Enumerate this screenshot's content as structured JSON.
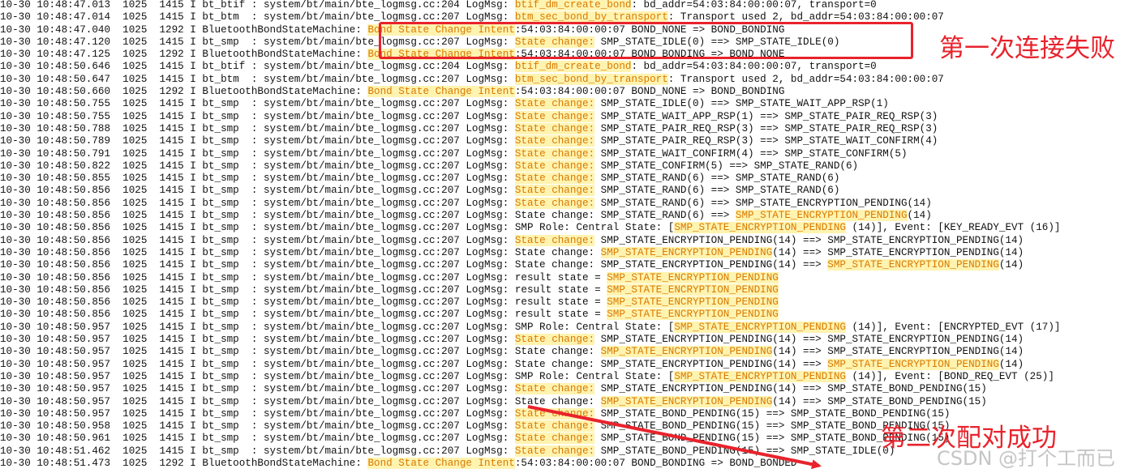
{
  "colors": {
    "highlight_bg": "#fff3b0",
    "highlight_text": "#d97a00",
    "annotation_red": "#e8232c"
  },
  "annotations": {
    "first_fail": "第一次连接失败",
    "second_success": "第二次配对成功"
  },
  "watermark": "CSDN @打个工而已",
  "log_lines": [
    [
      "10-30 10:48:47.013  1025  1415 I bt_btif : system/bt/main/bte_logmsg.cc:204 LogMsg: ",
      {
        "t": "btif_dm_create_bond",
        "h": true
      },
      ": bd_addr=54:03:84:00:00:07, transport=0"
    ],
    [
      "10-30 10:48:47.014  1025  1415 I bt_btm  : system/bt/main/bte_logmsg.cc:207 LogMsg: ",
      {
        "t": "btm_sec_bond_by_transport",
        "h": true
      },
      ": Transport used 2, bd_addr=54:03:84:00:00:07"
    ],
    [
      "10-30 10:48:47.040  1025  1292 I BluetoothBondStateMachine: ",
      {
        "t": "Bond State Change Intent",
        "h": true
      },
      ":54:03:84:00:00:07 BOND_NONE => BOND_BONDING"
    ],
    [
      "10-30 10:48:47.120  1025  1415 I bt_smp  : system/bt/main/bte_logmsg.cc:207 LogMsg: ",
      {
        "t": "State change:",
        "h": true
      },
      " SMP_STATE_IDLE(0) ==> SMP_STATE_IDLE(0)"
    ],
    [
      "10-30 10:48:47.125  1025  1292 I BluetoothBondStateMachine: ",
      {
        "t": "Bond State Change Intent",
        "h": true
      },
      ":54:03:84:00:00:07 BOND_BONDING => BOND_NONE"
    ],
    [
      "10-30 10:48:50.646  1025  1415 I bt_btif : system/bt/main/bte_logmsg.cc:204 LogMsg: ",
      {
        "t": "btif_dm_create_bond",
        "h": true
      },
      ": bd_addr=54:03:84:00:00:07, transport=0"
    ],
    [
      "10-30 10:48:50.647  1025  1415 I bt_btm  : system/bt/main/bte_logmsg.cc:207 LogMsg: ",
      {
        "t": "btm_sec_bond_by_transport",
        "h": true
      },
      ": Transport used 2, bd_addr=54:03:84:00:00:07"
    ],
    [
      "10-30 10:48:50.660  1025  1292 I BluetoothBondStateMachine: ",
      {
        "t": "Bond State Change Intent",
        "h": true
      },
      ":54:03:84:00:00:07 BOND_NONE => BOND_BONDING"
    ],
    [
      "10-30 10:48:50.755  1025  1415 I bt_smp  : system/bt/main/bte_logmsg.cc:207 LogMsg: ",
      {
        "t": "State change:",
        "h": true
      },
      " SMP_STATE_IDLE(0) ==> SMP_STATE_WAIT_APP_RSP(1)"
    ],
    [
      "10-30 10:48:50.755  1025  1415 I bt_smp  : system/bt/main/bte_logmsg.cc:207 LogMsg: ",
      {
        "t": "State change:",
        "h": true
      },
      " SMP_STATE_WAIT_APP_RSP(1) ==> SMP_STATE_PAIR_REQ_RSP(3)"
    ],
    [
      "10-30 10:48:50.788  1025  1415 I bt_smp  : system/bt/main/bte_logmsg.cc:207 LogMsg: ",
      {
        "t": "State change:",
        "h": true
      },
      " SMP_STATE_PAIR_REQ_RSP(3) ==> SMP_STATE_PAIR_REQ_RSP(3)"
    ],
    [
      "10-30 10:48:50.789  1025  1415 I bt_smp  : system/bt/main/bte_logmsg.cc:207 LogMsg: ",
      {
        "t": "State change:",
        "h": true
      },
      " SMP_STATE_PAIR_REQ_RSP(3) ==> SMP_STATE_WAIT_CONFIRM(4)"
    ],
    [
      "10-30 10:48:50.791  1025  1415 I bt_smp  : system/bt/main/bte_logmsg.cc:207 LogMsg: ",
      {
        "t": "State change:",
        "h": true
      },
      " SMP_STATE_WAIT_CONFIRM(4) ==> SMP_STATE_CONFIRM(5)"
    ],
    [
      "10-30 10:48:50.822  1025  1415 I bt_smp  : system/bt/main/bte_logmsg.cc:207 LogMsg: ",
      {
        "t": "State change:",
        "h": true
      },
      " SMP_STATE_CONFIRM(5) ==> SMP_STATE_RAND(6)"
    ],
    [
      "10-30 10:48:50.855  1025  1415 I bt_smp  : system/bt/main/bte_logmsg.cc:207 LogMsg: ",
      {
        "t": "State change:",
        "h": true
      },
      " SMP_STATE_RAND(6) ==> SMP_STATE_RAND(6)"
    ],
    [
      "10-30 10:48:50.856  1025  1415 I bt_smp  : system/bt/main/bte_logmsg.cc:207 LogMsg: ",
      {
        "t": "State change:",
        "h": true
      },
      " SMP_STATE_RAND(6) ==> SMP_STATE_RAND(6)"
    ],
    [
      "10-30 10:48:50.856  1025  1415 I bt_smp  : system/bt/main/bte_logmsg.cc:207 LogMsg: ",
      {
        "t": "State change:",
        "h": true
      },
      " SMP_STATE_RAND(6) ==> SMP_STATE_ENCRYPTION_PENDING(14)"
    ],
    [
      "10-30 10:48:50.856  1025  1415 I bt_smp  : system/bt/main/bte_logmsg.cc:207 LogMsg: State change: SMP_STATE_RAND(6) ==> ",
      {
        "t": "SMP_STATE_ENCRYPTION_PENDING",
        "h": true
      },
      "(14)"
    ],
    [
      "10-30 10:48:50.856  1025  1415 I bt_smp  : system/bt/main/bte_logmsg.cc:207 LogMsg: SMP Role: Central State: [",
      {
        "t": "SMP_STATE_ENCRYPTION_PENDING",
        "h": true
      },
      " (14)], Event: [KEY_READY_EVT (16)]"
    ],
    [
      "10-30 10:48:50.856  1025  1415 I bt_smp  : system/bt/main/bte_logmsg.cc:207 LogMsg: ",
      {
        "t": "State change:",
        "h": true
      },
      " SMP_STATE_ENCRYPTION_PENDING(14) ==> SMP_STATE_ENCRYPTION_PENDING(14)"
    ],
    [
      "10-30 10:48:50.856  1025  1415 I bt_smp  : system/bt/main/bte_logmsg.cc:207 LogMsg: State change: ",
      {
        "t": "SMP_STATE_ENCRYPTION_PENDING",
        "h": true
      },
      "(14) ==> SMP_STATE_ENCRYPTION_PENDING(14)"
    ],
    [
      "10-30 10:48:50.856  1025  1415 I bt_smp  : system/bt/main/bte_logmsg.cc:207 LogMsg: State change: SMP_STATE_ENCRYPTION_PENDING(14) ==> ",
      {
        "t": "SMP_STATE_ENCRYPTION_PENDING",
        "h": true
      },
      "(14)"
    ],
    [
      "10-30 10:48:50.856  1025  1415 I bt_smp  : system/bt/main/bte_logmsg.cc:207 LogMsg: result state = ",
      {
        "t": "SMP_STATE_ENCRYPTION_PENDING",
        "h": true
      },
      ""
    ],
    [
      "10-30 10:48:50.856  1025  1415 I bt_smp  : system/bt/main/bte_logmsg.cc:207 LogMsg: result state = ",
      {
        "t": "SMP_STATE_ENCRYPTION_PENDING",
        "h": true
      },
      ""
    ],
    [
      "10-30 10:48:50.856  1025  1415 I bt_smp  : system/bt/main/bte_logmsg.cc:207 LogMsg: result state = ",
      {
        "t": "SMP_STATE_ENCRYPTION_PENDING",
        "h": true
      },
      ""
    ],
    [
      "10-30 10:48:50.856  1025  1415 I bt_smp  : system/bt/main/bte_logmsg.cc:207 LogMsg: result state = ",
      {
        "t": "SMP_STATE_ENCRYPTION_PENDING",
        "h": true
      },
      ""
    ],
    [
      "10-30 10:48:50.957  1025  1415 I bt_smp  : system/bt/main/bte_logmsg.cc:207 LogMsg: SMP Role: Central State: [",
      {
        "t": "SMP_STATE_ENCRYPTION_PENDING",
        "h": true
      },
      " (14)], Event: [ENCRYPTED_EVT (17)]"
    ],
    [
      "10-30 10:48:50.957  1025  1415 I bt_smp  : system/bt/main/bte_logmsg.cc:207 LogMsg: ",
      {
        "t": "State change:",
        "h": true
      },
      " SMP_STATE_ENCRYPTION_PENDING(14) ==> SMP_STATE_ENCRYPTION_PENDING(14)"
    ],
    [
      "10-30 10:48:50.957  1025  1415 I bt_smp  : system/bt/main/bte_logmsg.cc:207 LogMsg: State change: ",
      {
        "t": "SMP_STATE_ENCRYPTION_PENDING",
        "h": true
      },
      "(14) ==> SMP_STATE_ENCRYPTION_PENDING(14)"
    ],
    [
      "10-30 10:48:50.957  1025  1415 I bt_smp  : system/bt/main/bte_logmsg.cc:207 LogMsg: State change: SMP_STATE_ENCRYPTION_PENDING(14) ==> ",
      {
        "t": "SMP_STATE_ENCRYPTION_PENDING",
        "h": true
      },
      "(14)"
    ],
    [
      "10-30 10:48:50.957  1025  1415 I bt_smp  : system/bt/main/bte_logmsg.cc:207 LogMsg: SMP Role: Central State: [",
      {
        "t": "SMP_STATE_ENCRYPTION_PENDING",
        "h": true
      },
      " (14)], Event: [BOND_REQ_EVT (25)]"
    ],
    [
      "10-30 10:48:50.957  1025  1415 I bt_smp  : system/bt/main/bte_logmsg.cc:207 LogMsg: ",
      {
        "t": "State change:",
        "h": true
      },
      " SMP_STATE_ENCRYPTION_PENDING(14) ==> SMP_STATE_BOND_PENDING(15)"
    ],
    [
      "10-30 10:48:50.957  1025  1415 I bt_smp  : system/bt/main/bte_logmsg.cc:207 LogMsg: State change: ",
      {
        "t": "SMP_STATE_ENCRYPTION_PENDING",
        "h": true
      },
      "(14) ==> SMP_STATE_BOND_PENDING(15)"
    ],
    [
      "10-30 10:48:50.957  1025  1415 I bt_smp  : system/bt/main/bte_logmsg.cc:207 LogMsg: ",
      {
        "t": "State change:",
        "h": true
      },
      " SMP_STATE_BOND_PENDING(15) ==> SMP_STATE_BOND_PENDING(15)"
    ],
    [
      "10-30 10:48:50.958  1025  1415 I bt_smp  : system/bt/main/bte_logmsg.cc:207 LogMsg: ",
      {
        "t": "State change:",
        "h": true
      },
      " SMP_STATE_BOND_PENDING(15) ==> SMP_STATE_BOND_PENDING(15)"
    ],
    [
      "10-30 10:48:50.961  1025  1415 I bt_smp  : system/bt/main/bte_logmsg.cc:207 LogMsg: ",
      {
        "t": "State change:",
        "h": true
      },
      " SMP_STATE_BOND_PENDING(15) ==> SMP_STATE_BOND_PENDING(15)"
    ],
    [
      "10-30 10:48:51.462  1025  1415 I bt_smp  : system/bt/main/bte_logmsg.cc:207 LogMsg: ",
      {
        "t": "State change:",
        "h": true
      },
      " SMP_STATE_BOND_PENDING(15) ==> SMP_STATE_IDLE(0)"
    ],
    [
      "10-30 10:48:51.473  1025  1292 I BluetoothBondStateMachine: ",
      {
        "t": "Bond State Change Intent",
        "h": true
      },
      ":54:03:84:00:00:07 BOND_BONDING => BOND_BONDED"
    ]
  ]
}
